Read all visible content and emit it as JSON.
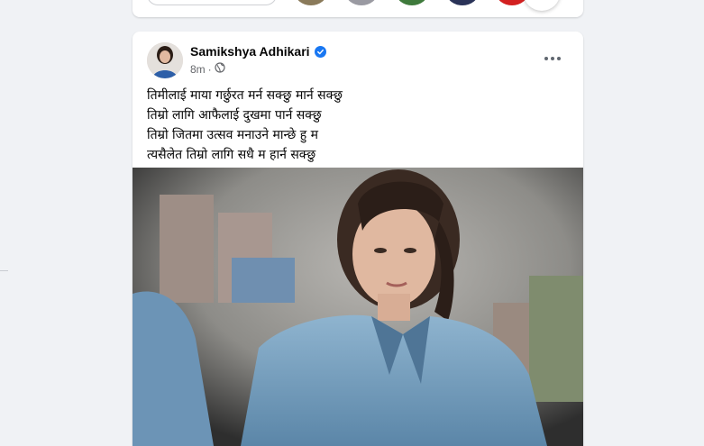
{
  "post": {
    "author": "Samikshya Adhikari",
    "time": "8m",
    "separator": "·",
    "caption_lines": [
      "तिमीलाई माया गर्छुरत मर्न सक्छु मार्न सक्छु",
      "तिम्रो लागि आफैलाई  दुखमा पार्न सक्छु",
      "तिम्रो जितमा उत्सव मनाउने मान्छे हु म",
      "त्यसैलेत तिम्रो लागि सधै म हार्न सक्छु"
    ]
  },
  "icons": {
    "verified": "verified-badge-icon",
    "audience": "globe-icon",
    "more": "more-options-icon"
  },
  "colors": {
    "accent": "#1877f2",
    "secondary_text": "#65676b",
    "background": "#f0f2f5"
  }
}
